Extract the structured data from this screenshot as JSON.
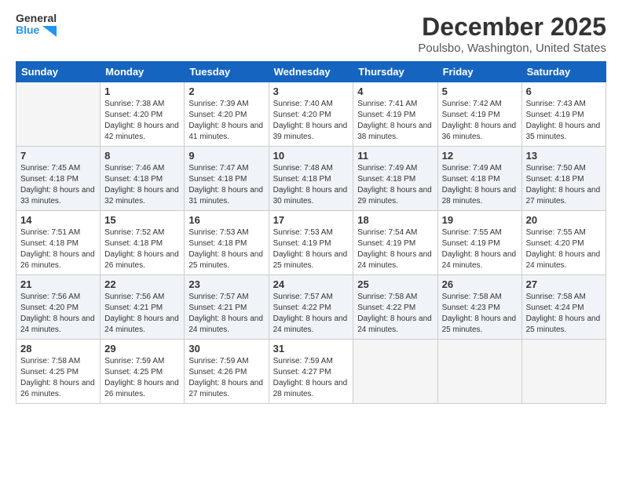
{
  "logo": {
    "line1": "General",
    "line2": "Blue"
  },
  "title": "December 2025",
  "subtitle": "Poulsbo, Washington, United States",
  "days_header": [
    "Sunday",
    "Monday",
    "Tuesday",
    "Wednesday",
    "Thursday",
    "Friday",
    "Saturday"
  ],
  "weeks": [
    [
      {
        "day": "",
        "sunrise": "",
        "sunset": "",
        "daylight": ""
      },
      {
        "day": "1",
        "sunrise": "Sunrise: 7:38 AM",
        "sunset": "Sunset: 4:20 PM",
        "daylight": "Daylight: 8 hours and 42 minutes."
      },
      {
        "day": "2",
        "sunrise": "Sunrise: 7:39 AM",
        "sunset": "Sunset: 4:20 PM",
        "daylight": "Daylight: 8 hours and 41 minutes."
      },
      {
        "day": "3",
        "sunrise": "Sunrise: 7:40 AM",
        "sunset": "Sunset: 4:20 PM",
        "daylight": "Daylight: 8 hours and 39 minutes."
      },
      {
        "day": "4",
        "sunrise": "Sunrise: 7:41 AM",
        "sunset": "Sunset: 4:19 PM",
        "daylight": "Daylight: 8 hours and 38 minutes."
      },
      {
        "day": "5",
        "sunrise": "Sunrise: 7:42 AM",
        "sunset": "Sunset: 4:19 PM",
        "daylight": "Daylight: 8 hours and 36 minutes."
      },
      {
        "day": "6",
        "sunrise": "Sunrise: 7:43 AM",
        "sunset": "Sunset: 4:19 PM",
        "daylight": "Daylight: 8 hours and 35 minutes."
      }
    ],
    [
      {
        "day": "7",
        "sunrise": "Sunrise: 7:45 AM",
        "sunset": "Sunset: 4:18 PM",
        "daylight": "Daylight: 8 hours and 33 minutes."
      },
      {
        "day": "8",
        "sunrise": "Sunrise: 7:46 AM",
        "sunset": "Sunset: 4:18 PM",
        "daylight": "Daylight: 8 hours and 32 minutes."
      },
      {
        "day": "9",
        "sunrise": "Sunrise: 7:47 AM",
        "sunset": "Sunset: 4:18 PM",
        "daylight": "Daylight: 8 hours and 31 minutes."
      },
      {
        "day": "10",
        "sunrise": "Sunrise: 7:48 AM",
        "sunset": "Sunset: 4:18 PM",
        "daylight": "Daylight: 8 hours and 30 minutes."
      },
      {
        "day": "11",
        "sunrise": "Sunrise: 7:49 AM",
        "sunset": "Sunset: 4:18 PM",
        "daylight": "Daylight: 8 hours and 29 minutes."
      },
      {
        "day": "12",
        "sunrise": "Sunrise: 7:49 AM",
        "sunset": "Sunset: 4:18 PM",
        "daylight": "Daylight: 8 hours and 28 minutes."
      },
      {
        "day": "13",
        "sunrise": "Sunrise: 7:50 AM",
        "sunset": "Sunset: 4:18 PM",
        "daylight": "Daylight: 8 hours and 27 minutes."
      }
    ],
    [
      {
        "day": "14",
        "sunrise": "Sunrise: 7:51 AM",
        "sunset": "Sunset: 4:18 PM",
        "daylight": "Daylight: 8 hours and 26 minutes."
      },
      {
        "day": "15",
        "sunrise": "Sunrise: 7:52 AM",
        "sunset": "Sunset: 4:18 PM",
        "daylight": "Daylight: 8 hours and 26 minutes."
      },
      {
        "day": "16",
        "sunrise": "Sunrise: 7:53 AM",
        "sunset": "Sunset: 4:18 PM",
        "daylight": "Daylight: 8 hours and 25 minutes."
      },
      {
        "day": "17",
        "sunrise": "Sunrise: 7:53 AM",
        "sunset": "Sunset: 4:19 PM",
        "daylight": "Daylight: 8 hours and 25 minutes."
      },
      {
        "day": "18",
        "sunrise": "Sunrise: 7:54 AM",
        "sunset": "Sunset: 4:19 PM",
        "daylight": "Daylight: 8 hours and 24 minutes."
      },
      {
        "day": "19",
        "sunrise": "Sunrise: 7:55 AM",
        "sunset": "Sunset: 4:19 PM",
        "daylight": "Daylight: 8 hours and 24 minutes."
      },
      {
        "day": "20",
        "sunrise": "Sunrise: 7:55 AM",
        "sunset": "Sunset: 4:20 PM",
        "daylight": "Daylight: 8 hours and 24 minutes."
      }
    ],
    [
      {
        "day": "21",
        "sunrise": "Sunrise: 7:56 AM",
        "sunset": "Sunset: 4:20 PM",
        "daylight": "Daylight: 8 hours and 24 minutes."
      },
      {
        "day": "22",
        "sunrise": "Sunrise: 7:56 AM",
        "sunset": "Sunset: 4:21 PM",
        "daylight": "Daylight: 8 hours and 24 minutes."
      },
      {
        "day": "23",
        "sunrise": "Sunrise: 7:57 AM",
        "sunset": "Sunset: 4:21 PM",
        "daylight": "Daylight: 8 hours and 24 minutes."
      },
      {
        "day": "24",
        "sunrise": "Sunrise: 7:57 AM",
        "sunset": "Sunset: 4:22 PM",
        "daylight": "Daylight: 8 hours and 24 minutes."
      },
      {
        "day": "25",
        "sunrise": "Sunrise: 7:58 AM",
        "sunset": "Sunset: 4:22 PM",
        "daylight": "Daylight: 8 hours and 24 minutes."
      },
      {
        "day": "26",
        "sunrise": "Sunrise: 7:58 AM",
        "sunset": "Sunset: 4:23 PM",
        "daylight": "Daylight: 8 hours and 25 minutes."
      },
      {
        "day": "27",
        "sunrise": "Sunrise: 7:58 AM",
        "sunset": "Sunset: 4:24 PM",
        "daylight": "Daylight: 8 hours and 25 minutes."
      }
    ],
    [
      {
        "day": "28",
        "sunrise": "Sunrise: 7:58 AM",
        "sunset": "Sunset: 4:25 PM",
        "daylight": "Daylight: 8 hours and 26 minutes."
      },
      {
        "day": "29",
        "sunrise": "Sunrise: 7:59 AM",
        "sunset": "Sunset: 4:25 PM",
        "daylight": "Daylight: 8 hours and 26 minutes."
      },
      {
        "day": "30",
        "sunrise": "Sunrise: 7:59 AM",
        "sunset": "Sunset: 4:26 PM",
        "daylight": "Daylight: 8 hours and 27 minutes."
      },
      {
        "day": "31",
        "sunrise": "Sunrise: 7:59 AM",
        "sunset": "Sunset: 4:27 PM",
        "daylight": "Daylight: 8 hours and 28 minutes."
      },
      {
        "day": "",
        "sunrise": "",
        "sunset": "",
        "daylight": ""
      },
      {
        "day": "",
        "sunrise": "",
        "sunset": "",
        "daylight": ""
      },
      {
        "day": "",
        "sunrise": "",
        "sunset": "",
        "daylight": ""
      }
    ]
  ]
}
